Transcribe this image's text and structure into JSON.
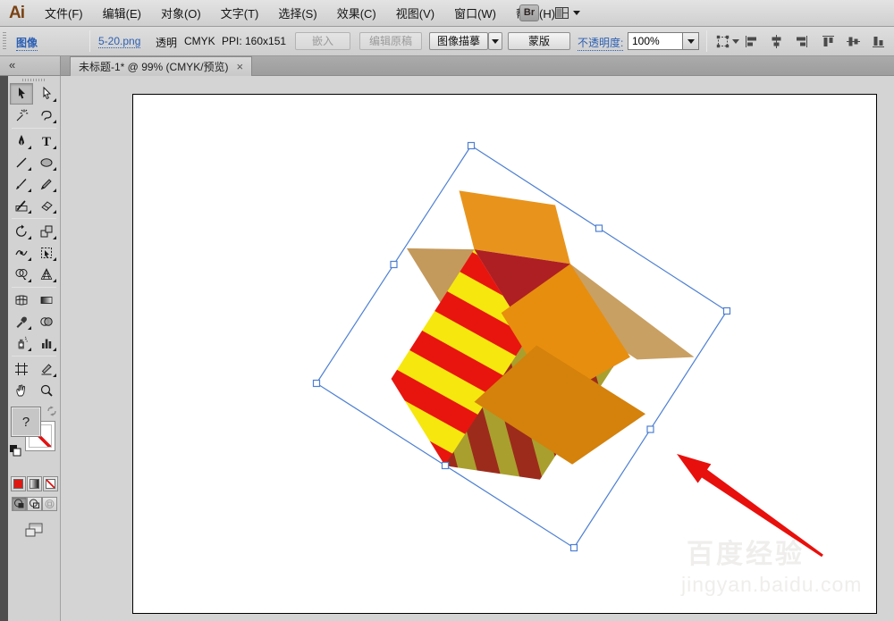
{
  "menu_bar": {
    "logo": "Ai",
    "items": [
      "文件(F)",
      "编辑(E)",
      "对象(O)",
      "文字(T)",
      "选择(S)",
      "效果(C)",
      "视图(V)",
      "窗口(W)",
      "帮助(H)"
    ],
    "bridge_button": "Br"
  },
  "options_bar": {
    "context_label": "图像",
    "file_name": "5-20.png",
    "transparency": "透明",
    "color_mode": "CMYK",
    "ppi": "PPI: 160x151",
    "embed_button": "嵌入",
    "edit_original_button": "编辑原稿",
    "image_trace_button": "图像描摹",
    "mask_button": "蒙版",
    "opacity_label": "不透明度:",
    "opacity_value": "100%"
  },
  "tab_bar": {
    "active_tab": "未标题-1* @ 99% (CMYK/预览)"
  },
  "toolbar": {
    "tools": [
      "selection",
      "direct-selection",
      "magic-wand",
      "lasso",
      "pen",
      "type",
      "line-segment",
      "ellipse",
      "paintbrush",
      "pencil",
      "blob-brush",
      "eraser",
      "rotate",
      "scale",
      "width",
      "free-transform",
      "shape-builder",
      "perspective-grid",
      "mesh",
      "gradient",
      "eyedropper",
      "blend",
      "symbol-sprayer",
      "column-graph",
      "artboard",
      "slice",
      "hand",
      "zoom"
    ],
    "selected_tool": "selection"
  },
  "glyphs": {
    "collapse": "«",
    "close_tab": "×",
    "type_tool": "T",
    "fill_question": "?"
  },
  "canvas": {
    "zoom_level": "99%",
    "colors": {
      "selection_blue": "#4E80D4",
      "arrow_red": "#E8100C",
      "flap_orange": "#E8941C",
      "flap_inner_orange": "#E78E0E",
      "flap_front_orange": "#D4820C",
      "flap_tan": "#C9A063",
      "interior_red": "#AE1F24",
      "face_yellow": "#F6E70E",
      "stripe_red": "#E8150F",
      "face_darkred": "#9C2B1B",
      "stripe_olive": "#A99F2E"
    }
  },
  "watermark": {
    "line1": "百度经验",
    "line2": "jingyan.baidu.com"
  }
}
